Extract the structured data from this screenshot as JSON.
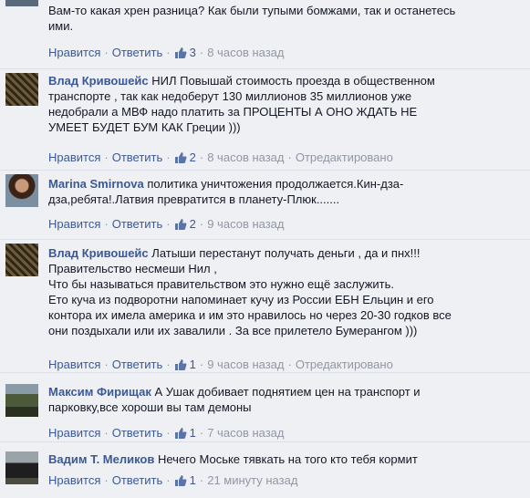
{
  "action_labels": {
    "like": "Нравится",
    "reply": "Ответить",
    "edited": "Отредактировано"
  },
  "comments": [
    {
      "author": "",
      "lines": [
        "Вам-то какая хрен разница? Как были тупыми бомжами, так и останетесь",
        "ими."
      ],
      "likes": "3",
      "time": "8 часов назад"
    },
    {
      "author": "Влад Кривошейс",
      "lines": [
        "НИЛ Повышай стоимость проезда в общественном",
        "транспорте , так как недоберут 130 миллионов 35 миллионов уже",
        "недобрали а МВФ надо платить за ПРОЦЕНТЫ А ОНО ЖДАТЬ НЕ",
        "УМЕЕТ БУДЕТ БУМ КАК Греции )))"
      ],
      "likes": "2",
      "time": "8 часов назад"
    },
    {
      "author": "Marina Smirnova",
      "lines": [
        "политика уничтожения продолжается.Кин-дза-",
        "дза,ребята!.Латвия превратится в планету-Плюк......."
      ],
      "likes": "2",
      "time": "9 часов назад"
    },
    {
      "author": "Влад Кривошейс",
      "lines": [
        "Латыши перестанут получать деньги , да и пнх!!!",
        "Правительство несмеши Нил ,",
        "Что бы называться правительством это нужно ещё заслужить.",
        "Ето куча из подворотни напоминает кучу из России ЕБН Ельцин и его",
        "контора их имела америка и им это нравилось но через 20-30 годков все",
        "они поздыхали или их завалили . За все прилетело Бумерангом )))"
      ],
      "likes": "1",
      "time": "9 часов назад"
    },
    {
      "author": "Максим Фирищак",
      "lines": [
        "А Ушак добивает поднятием цен на транспорт и",
        "парковку,все хороши вы там демоны"
      ],
      "likes": "1",
      "time": "7 часов назад"
    },
    {
      "author": "Вадим Т. Меликов",
      "lines": [
        "Нечего Моське тявкать на того кто тебя кормит"
      ],
      "likes": "1",
      "time": "21 минуту назад"
    }
  ],
  "colors": {
    "link": "#3b5998",
    "meta": "#9197a3",
    "background": "#eef0f4"
  }
}
